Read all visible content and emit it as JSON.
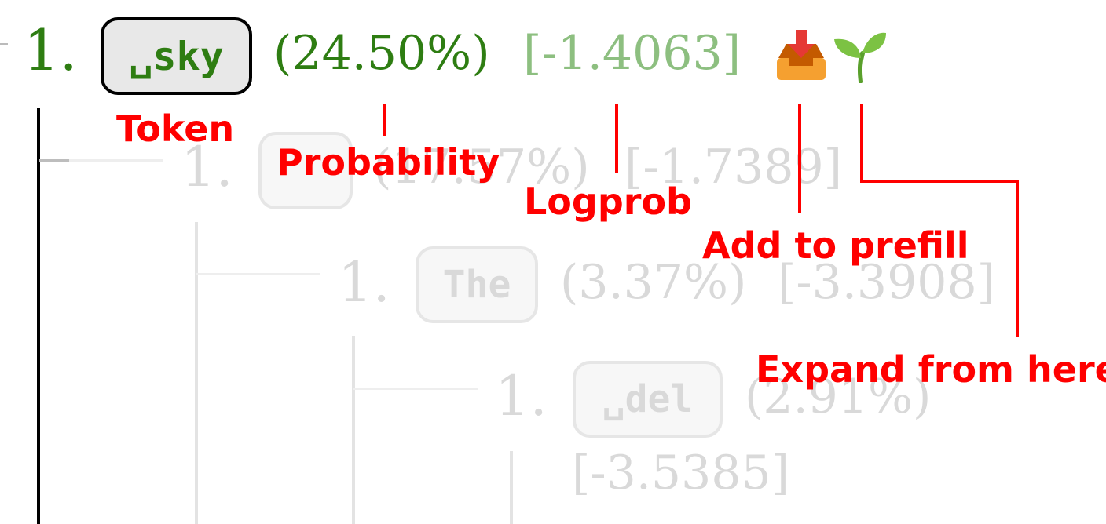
{
  "tree": {
    "root": {
      "index": "1.",
      "token": "␣sky",
      "probability": "(24.50%)",
      "logprob": "[-1.4063]",
      "actions": [
        {
          "name": "add-to-prefill",
          "icon": "inbox-tray-icon"
        },
        {
          "name": "expand-from-here",
          "icon": "seedling-icon"
        }
      ],
      "color": "#2e7d12",
      "logprob_color": "#8dbf80"
    },
    "children": [
      {
        "index": "1.",
        "token": "\n",
        "probability": "(17.57%)",
        "logprob": "[-1.7389]"
      },
      {
        "index": "1.",
        "token": "The",
        "probability": "(3.37%)",
        "logprob": "[-3.3908]"
      },
      {
        "index": "1.",
        "token": "␣del",
        "probability": "(2.91%)",
        "logprob": "[-3.5385]"
      }
    ],
    "faded_color": "#d9d9d9"
  },
  "annotations": {
    "token": "Token",
    "probability": "Probability",
    "logprob": "Logprob",
    "add_to_prefill": "Add to prefill",
    "expand": "Expand from here",
    "color": "#ff0000"
  }
}
